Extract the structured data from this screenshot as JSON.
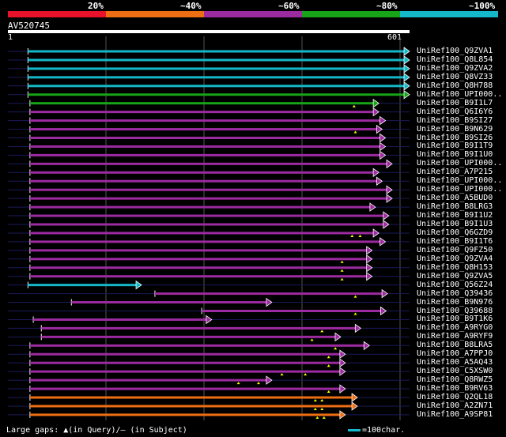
{
  "legend": [
    {
      "label": "20%",
      "color": "#e8132b"
    },
    {
      "label": "~40%",
      "color": "#ee6e13"
    },
    {
      "label": "~60%",
      "color": "#9c2aa0"
    },
    {
      "label": "~80%",
      "color": "#18a418"
    },
    {
      "label": "~100%",
      "color": "#14b8c8"
    }
  ],
  "query": {
    "name": "AV520745",
    "start_label": "1",
    "end_label": "601",
    "length": 601
  },
  "footer": {
    "gaps_text": "Large gaps: ▲(in Query)/– (in Subject)",
    "scale_text": "=100char.",
    "scale_color": "#14b8c8"
  },
  "hits": [
    {
      "name": "UniRef100_Q9ZVA1",
      "color": "#14b8c8",
      "start": 30,
      "end": 601,
      "gaps": []
    },
    {
      "name": "UniRef100_Q8L854",
      "color": "#14b8c8",
      "start": 30,
      "end": 601,
      "gaps": []
    },
    {
      "name": "UniRef100_Q9ZVA2",
      "color": "#14b8c8",
      "start": 30,
      "end": 601,
      "gaps": []
    },
    {
      "name": "UniRef100_Q8VZ33",
      "color": "#14b8c8",
      "start": 30,
      "end": 601,
      "gaps": []
    },
    {
      "name": "UniRef100_Q8H788",
      "color": "#14b8c8",
      "start": 30,
      "end": 601,
      "gaps": []
    },
    {
      "name": "UniRef100_UPI000..",
      "color": "#18a418",
      "start": 30,
      "end": 601,
      "gaps": []
    },
    {
      "name": "UniRef100_B9I1L7",
      "color": "#18a418",
      "start": 33,
      "end": 555,
      "gaps": [
        518
      ]
    },
    {
      "name": "UniRef100_Q6I6Y6",
      "color": "#9c2aa0",
      "start": 33,
      "end": 555,
      "gaps": []
    },
    {
      "name": "UniRef100_B9SI27",
      "color": "#9c2aa0",
      "start": 33,
      "end": 565,
      "gaps": []
    },
    {
      "name": "UniRef100_B9N629",
      "color": "#9c2aa0",
      "start": 33,
      "end": 560,
      "gaps": [
        520
      ]
    },
    {
      "name": "UniRef100_B9SI26",
      "color": "#9c2aa0",
      "start": 33,
      "end": 565,
      "gaps": []
    },
    {
      "name": "UniRef100_B9I1T9",
      "color": "#9c2aa0",
      "start": 33,
      "end": 565,
      "gaps": []
    },
    {
      "name": "UniRef100_B9I1U0",
      "color": "#9c2aa0",
      "start": 33,
      "end": 565,
      "gaps": []
    },
    {
      "name": "UniRef100_UPI000..",
      "color": "#9c2aa0",
      "start": 33,
      "end": 575,
      "gaps": []
    },
    {
      "name": "UniRef100_A7P215",
      "color": "#9c2aa0",
      "start": 33,
      "end": 555,
      "gaps": []
    },
    {
      "name": "UniRef100_UPI000..",
      "color": "#9c2aa0",
      "start": 33,
      "end": 560,
      "gaps": []
    },
    {
      "name": "UniRef100_UPI000..",
      "color": "#9c2aa0",
      "start": 33,
      "end": 575,
      "gaps": []
    },
    {
      "name": "UniRef100_A5BUD0",
      "color": "#9c2aa0",
      "start": 33,
      "end": 575,
      "gaps": []
    },
    {
      "name": "UniRef100_B8LRG3",
      "color": "#9c2aa0",
      "start": 33,
      "end": 550,
      "gaps": []
    },
    {
      "name": "UniRef100_B9I1U2",
      "color": "#9c2aa0",
      "start": 33,
      "end": 570,
      "gaps": []
    },
    {
      "name": "UniRef100_B9I1U3",
      "color": "#9c2aa0",
      "start": 33,
      "end": 570,
      "gaps": []
    },
    {
      "name": "UniRef100_Q6GZD9",
      "color": "#9c2aa0",
      "start": 33,
      "end": 555,
      "gaps": [
        515,
        527
      ]
    },
    {
      "name": "UniRef100_B9I1T6",
      "color": "#9c2aa0",
      "start": 33,
      "end": 565,
      "gaps": []
    },
    {
      "name": "UniRef100_Q9FZ50",
      "color": "#9c2aa0",
      "start": 33,
      "end": 545,
      "gaps": []
    },
    {
      "name": "UniRef100_Q9ZVA4",
      "color": "#9c2aa0",
      "start": 33,
      "end": 545,
      "gaps": [
        500
      ]
    },
    {
      "name": "UniRef100_Q8H153",
      "color": "#9c2aa0",
      "start": 33,
      "end": 545,
      "gaps": [
        500
      ]
    },
    {
      "name": "UniRef100_Q9ZVA5",
      "color": "#9c2aa0",
      "start": 33,
      "end": 545,
      "gaps": [
        500
      ]
    },
    {
      "name": "UniRef100_Q56Z24",
      "color": "#14b8c8",
      "start": 30,
      "end": 200,
      "gaps": []
    },
    {
      "name": "UniRef100_Q39436",
      "color": "#9c2aa0",
      "start": 220,
      "end": 568,
      "gaps": [
        520
      ]
    },
    {
      "name": "UniRef100_B9N976",
      "color": "#9c2aa0",
      "start": 95,
      "end": 395,
      "gaps": []
    },
    {
      "name": "UniRef100_Q39688",
      "color": "#9c2aa0",
      "start": 290,
      "end": 566,
      "gaps": [
        520
      ]
    },
    {
      "name": "UniRef100_B9T1K6",
      "color": "#9c2aa0",
      "start": 38,
      "end": 305,
      "gaps": []
    },
    {
      "name": "UniRef100_A9RYG0",
      "color": "#9c2aa0",
      "start": 50,
      "end": 528,
      "gaps": [
        470
      ]
    },
    {
      "name": "UniRef100_A9RYF9",
      "color": "#9c2aa0",
      "start": 50,
      "end": 498,
      "gaps": [
        455
      ]
    },
    {
      "name": "UniRef100_B8LRA5",
      "color": "#9c2aa0",
      "start": 33,
      "end": 541,
      "gaps": [
        490
      ]
    },
    {
      "name": "UniRef100_A7PPJ0",
      "color": "#9c2aa0",
      "start": 33,
      "end": 505,
      "gaps": [
        480
      ]
    },
    {
      "name": "UniRef100_A5AQ43",
      "color": "#9c2aa0",
      "start": 33,
      "end": 505,
      "gaps": [
        480
      ]
    },
    {
      "name": "UniRef100_C5XSW0",
      "color": "#9c2aa0",
      "start": 33,
      "end": 505,
      "gaps": [
        410,
        445
      ]
    },
    {
      "name": "UniRef100_Q8RWZ5",
      "color": "#9c2aa0",
      "start": 33,
      "end": 395,
      "gaps": [
        345,
        375
      ]
    },
    {
      "name": "UniRef100_B9RV63",
      "color": "#9c2aa0",
      "start": 33,
      "end": 505,
      "gaps": [
        480
      ]
    },
    {
      "name": "UniRef100_Q2QL18",
      "color": "#ee6e13",
      "start": 33,
      "end": 523,
      "gaps": [
        460,
        470
      ]
    },
    {
      "name": "UniRef100_A2ZN71",
      "color": "#ee6e13",
      "start": 33,
      "end": 523,
      "gaps": [
        460,
        470
      ]
    },
    {
      "name": "UniRef100_A9SP81",
      "color": "#ee6e13",
      "start": 33,
      "end": 505,
      "gaps": [
        463,
        473
      ]
    }
  ]
}
